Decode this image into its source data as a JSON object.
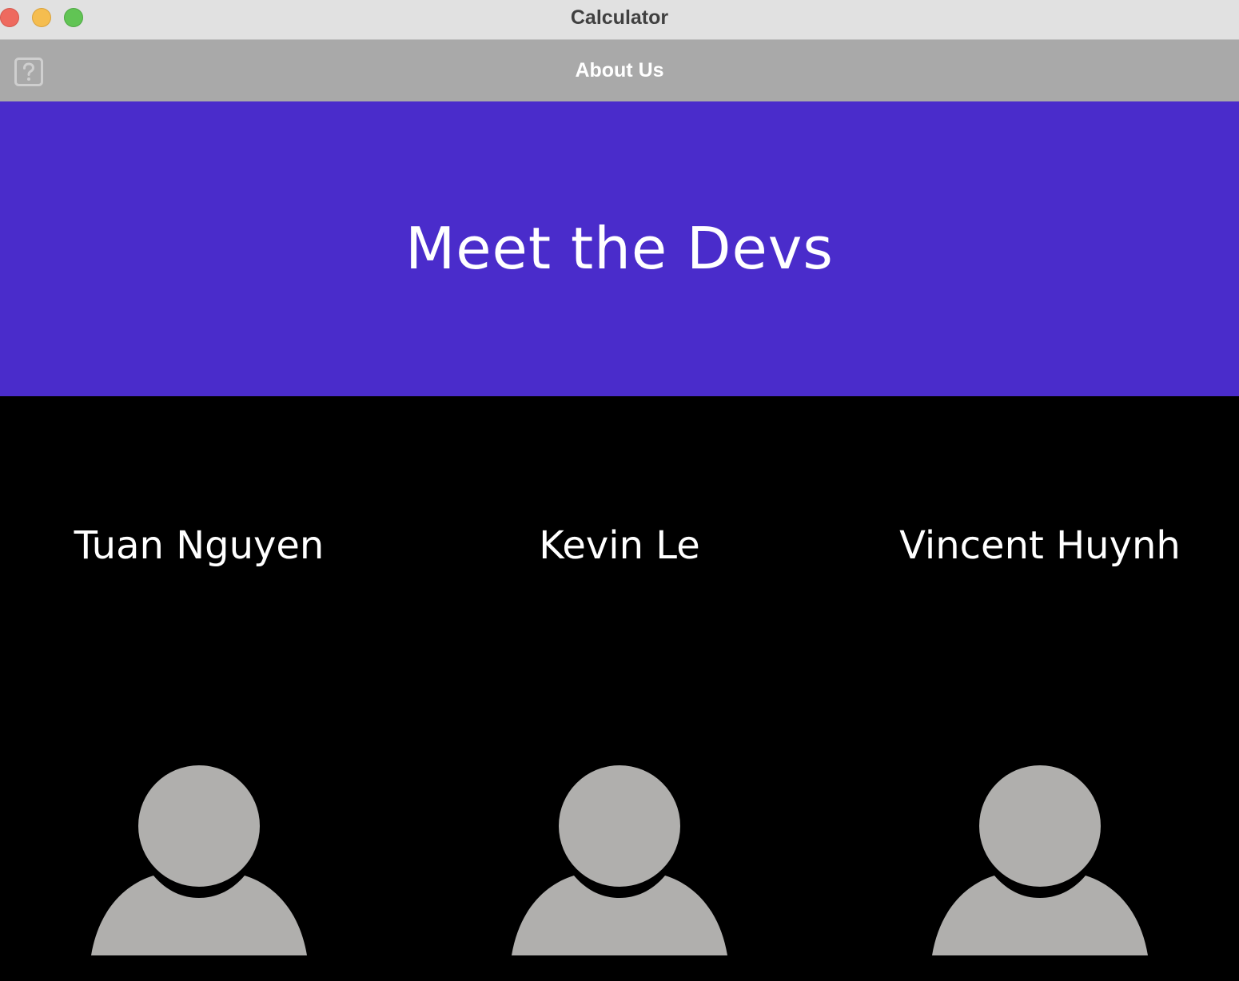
{
  "window": {
    "title": "Calculator"
  },
  "appbar": {
    "title": "About Us",
    "help_icon": "help-icon"
  },
  "hero": {
    "title": "Meet the Devs",
    "background_color": "#4a2ccb"
  },
  "devs": [
    {
      "name": "Tuan Nguyen",
      "avatar_icon": "person-avatar-icon"
    },
    {
      "name": "Kevin Le",
      "avatar_icon": "person-avatar-icon"
    },
    {
      "name": "Vincent Huynh",
      "avatar_icon": "person-avatar-icon"
    }
  ]
}
